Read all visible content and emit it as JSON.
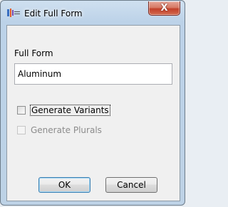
{
  "window": {
    "title": "Edit Full Form",
    "close_label": "X"
  },
  "form": {
    "field_label": "Full Form",
    "field_value": "Aluminum",
    "checkbox_variants": {
      "label": "Generate Variants",
      "checked": false,
      "enabled": true
    },
    "checkbox_plurals": {
      "label": "Generate Plurals",
      "checked": false,
      "enabled": false
    }
  },
  "buttons": {
    "ok": "OK",
    "cancel": "Cancel"
  },
  "icons": {
    "title": "app-dialog-icon",
    "close": "close-icon"
  },
  "colors": {
    "close_button": "#c2402a",
    "title_bar": "#bcd2e8",
    "client_bg": "#f0f0f0"
  }
}
